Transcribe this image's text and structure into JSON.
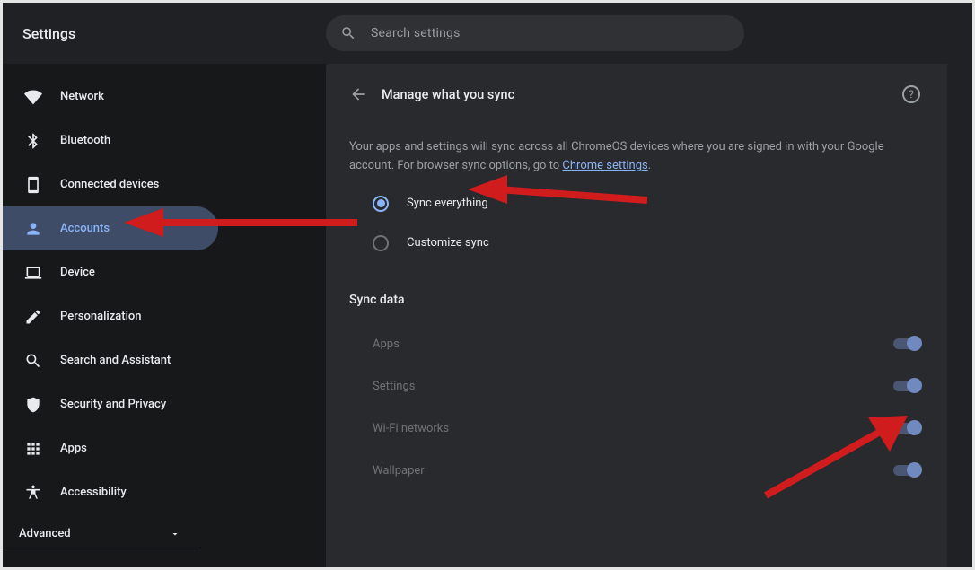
{
  "header": {
    "title": "Settings",
    "search_placeholder": "Search settings"
  },
  "sidebar": {
    "items": [
      {
        "id": "network",
        "label": "Network"
      },
      {
        "id": "bluetooth",
        "label": "Bluetooth"
      },
      {
        "id": "connected-devices",
        "label": "Connected devices"
      },
      {
        "id": "accounts",
        "label": "Accounts",
        "active": true
      },
      {
        "id": "device",
        "label": "Device"
      },
      {
        "id": "personalization",
        "label": "Personalization"
      },
      {
        "id": "search-assistant",
        "label": "Search and Assistant"
      },
      {
        "id": "security-privacy",
        "label": "Security and Privacy"
      },
      {
        "id": "apps",
        "label": "Apps"
      },
      {
        "id": "accessibility",
        "label": "Accessibility"
      }
    ],
    "advanced_label": "Advanced"
  },
  "main": {
    "page_title": "Manage what you sync",
    "description_a": "Your apps and settings will sync across all ChromeOS devices where you are signed in with your Google account. For browser sync options, go to ",
    "description_link": "Chrome settings",
    "description_b": ".",
    "radios": {
      "sync_everything": "Sync everything",
      "customize_sync": "Customize sync"
    },
    "selected_radio": "sync_everything",
    "sync_data_title": "Sync data",
    "sync_items": [
      {
        "label": "Apps",
        "on": true
      },
      {
        "label": "Settings",
        "on": true
      },
      {
        "label": "Wi-Fi networks",
        "on": true
      },
      {
        "label": "Wallpaper",
        "on": true
      }
    ]
  }
}
